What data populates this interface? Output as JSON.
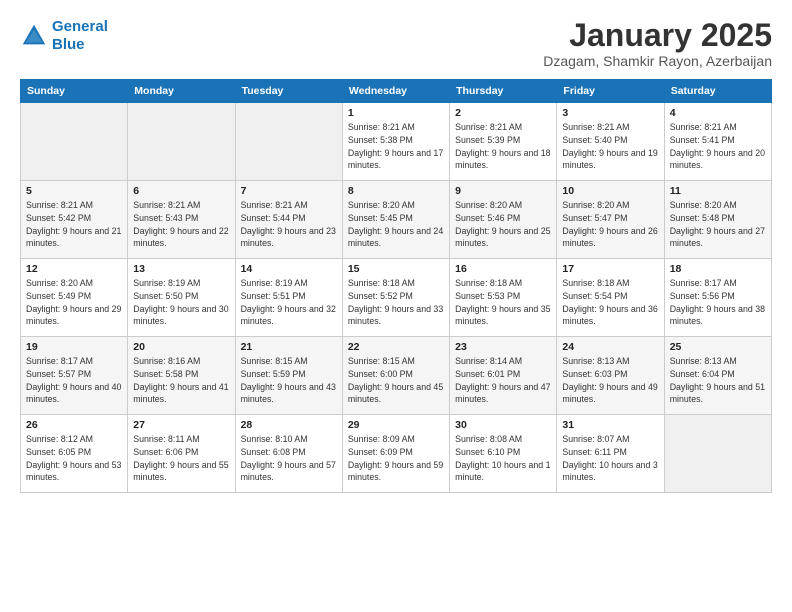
{
  "logo": {
    "line1": "General",
    "line2": "Blue"
  },
  "title": "January 2025",
  "subtitle": "Dzagam, Shamkir Rayon, Azerbaijan",
  "weekdays": [
    "Sunday",
    "Monday",
    "Tuesday",
    "Wednesday",
    "Thursday",
    "Friday",
    "Saturday"
  ],
  "weeks": [
    [
      {
        "day": "",
        "sunrise": "",
        "sunset": "",
        "daylight": ""
      },
      {
        "day": "",
        "sunrise": "",
        "sunset": "",
        "daylight": ""
      },
      {
        "day": "",
        "sunrise": "",
        "sunset": "",
        "daylight": ""
      },
      {
        "day": "1",
        "sunrise": "Sunrise: 8:21 AM",
        "sunset": "Sunset: 5:38 PM",
        "daylight": "Daylight: 9 hours and 17 minutes."
      },
      {
        "day": "2",
        "sunrise": "Sunrise: 8:21 AM",
        "sunset": "Sunset: 5:39 PM",
        "daylight": "Daylight: 9 hours and 18 minutes."
      },
      {
        "day": "3",
        "sunrise": "Sunrise: 8:21 AM",
        "sunset": "Sunset: 5:40 PM",
        "daylight": "Daylight: 9 hours and 19 minutes."
      },
      {
        "day": "4",
        "sunrise": "Sunrise: 8:21 AM",
        "sunset": "Sunset: 5:41 PM",
        "daylight": "Daylight: 9 hours and 20 minutes."
      }
    ],
    [
      {
        "day": "5",
        "sunrise": "Sunrise: 8:21 AM",
        "sunset": "Sunset: 5:42 PM",
        "daylight": "Daylight: 9 hours and 21 minutes."
      },
      {
        "day": "6",
        "sunrise": "Sunrise: 8:21 AM",
        "sunset": "Sunset: 5:43 PM",
        "daylight": "Daylight: 9 hours and 22 minutes."
      },
      {
        "day": "7",
        "sunrise": "Sunrise: 8:21 AM",
        "sunset": "Sunset: 5:44 PM",
        "daylight": "Daylight: 9 hours and 23 minutes."
      },
      {
        "day": "8",
        "sunrise": "Sunrise: 8:20 AM",
        "sunset": "Sunset: 5:45 PM",
        "daylight": "Daylight: 9 hours and 24 minutes."
      },
      {
        "day": "9",
        "sunrise": "Sunrise: 8:20 AM",
        "sunset": "Sunset: 5:46 PM",
        "daylight": "Daylight: 9 hours and 25 minutes."
      },
      {
        "day": "10",
        "sunrise": "Sunrise: 8:20 AM",
        "sunset": "Sunset: 5:47 PM",
        "daylight": "Daylight: 9 hours and 26 minutes."
      },
      {
        "day": "11",
        "sunrise": "Sunrise: 8:20 AM",
        "sunset": "Sunset: 5:48 PM",
        "daylight": "Daylight: 9 hours and 27 minutes."
      }
    ],
    [
      {
        "day": "12",
        "sunrise": "Sunrise: 8:20 AM",
        "sunset": "Sunset: 5:49 PM",
        "daylight": "Daylight: 9 hours and 29 minutes."
      },
      {
        "day": "13",
        "sunrise": "Sunrise: 8:19 AM",
        "sunset": "Sunset: 5:50 PM",
        "daylight": "Daylight: 9 hours and 30 minutes."
      },
      {
        "day": "14",
        "sunrise": "Sunrise: 8:19 AM",
        "sunset": "Sunset: 5:51 PM",
        "daylight": "Daylight: 9 hours and 32 minutes."
      },
      {
        "day": "15",
        "sunrise": "Sunrise: 8:18 AM",
        "sunset": "Sunset: 5:52 PM",
        "daylight": "Daylight: 9 hours and 33 minutes."
      },
      {
        "day": "16",
        "sunrise": "Sunrise: 8:18 AM",
        "sunset": "Sunset: 5:53 PM",
        "daylight": "Daylight: 9 hours and 35 minutes."
      },
      {
        "day": "17",
        "sunrise": "Sunrise: 8:18 AM",
        "sunset": "Sunset: 5:54 PM",
        "daylight": "Daylight: 9 hours and 36 minutes."
      },
      {
        "day": "18",
        "sunrise": "Sunrise: 8:17 AM",
        "sunset": "Sunset: 5:56 PM",
        "daylight": "Daylight: 9 hours and 38 minutes."
      }
    ],
    [
      {
        "day": "19",
        "sunrise": "Sunrise: 8:17 AM",
        "sunset": "Sunset: 5:57 PM",
        "daylight": "Daylight: 9 hours and 40 minutes."
      },
      {
        "day": "20",
        "sunrise": "Sunrise: 8:16 AM",
        "sunset": "Sunset: 5:58 PM",
        "daylight": "Daylight: 9 hours and 41 minutes."
      },
      {
        "day": "21",
        "sunrise": "Sunrise: 8:15 AM",
        "sunset": "Sunset: 5:59 PM",
        "daylight": "Daylight: 9 hours and 43 minutes."
      },
      {
        "day": "22",
        "sunrise": "Sunrise: 8:15 AM",
        "sunset": "Sunset: 6:00 PM",
        "daylight": "Daylight: 9 hours and 45 minutes."
      },
      {
        "day": "23",
        "sunrise": "Sunrise: 8:14 AM",
        "sunset": "Sunset: 6:01 PM",
        "daylight": "Daylight: 9 hours and 47 minutes."
      },
      {
        "day": "24",
        "sunrise": "Sunrise: 8:13 AM",
        "sunset": "Sunset: 6:03 PM",
        "daylight": "Daylight: 9 hours and 49 minutes."
      },
      {
        "day": "25",
        "sunrise": "Sunrise: 8:13 AM",
        "sunset": "Sunset: 6:04 PM",
        "daylight": "Daylight: 9 hours and 51 minutes."
      }
    ],
    [
      {
        "day": "26",
        "sunrise": "Sunrise: 8:12 AM",
        "sunset": "Sunset: 6:05 PM",
        "daylight": "Daylight: 9 hours and 53 minutes."
      },
      {
        "day": "27",
        "sunrise": "Sunrise: 8:11 AM",
        "sunset": "Sunset: 6:06 PM",
        "daylight": "Daylight: 9 hours and 55 minutes."
      },
      {
        "day": "28",
        "sunrise": "Sunrise: 8:10 AM",
        "sunset": "Sunset: 6:08 PM",
        "daylight": "Daylight: 9 hours and 57 minutes."
      },
      {
        "day": "29",
        "sunrise": "Sunrise: 8:09 AM",
        "sunset": "Sunset: 6:09 PM",
        "daylight": "Daylight: 9 hours and 59 minutes."
      },
      {
        "day": "30",
        "sunrise": "Sunrise: 8:08 AM",
        "sunset": "Sunset: 6:10 PM",
        "daylight": "Daylight: 10 hours and 1 minute."
      },
      {
        "day": "31",
        "sunrise": "Sunrise: 8:07 AM",
        "sunset": "Sunset: 6:11 PM",
        "daylight": "Daylight: 10 hours and 3 minutes."
      },
      {
        "day": "",
        "sunrise": "",
        "sunset": "",
        "daylight": ""
      }
    ]
  ]
}
